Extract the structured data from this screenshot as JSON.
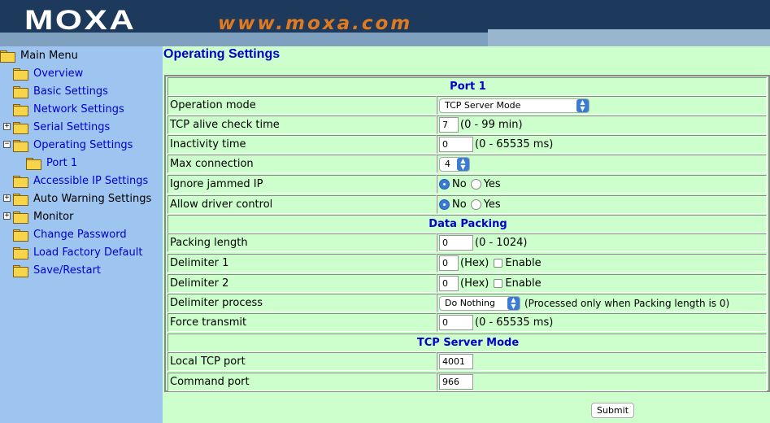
{
  "header": {
    "logo": "MOXA",
    "site": "www.moxa.com"
  },
  "sidebar": {
    "items": [
      {
        "label": "Main Menu",
        "level": 0,
        "toggle": "",
        "root": true
      },
      {
        "label": "Overview",
        "level": 1,
        "toggle": ""
      },
      {
        "label": "Basic Settings",
        "level": 1,
        "toggle": ""
      },
      {
        "label": "Network Settings",
        "level": 1,
        "toggle": ""
      },
      {
        "label": "Serial Settings",
        "level": 1,
        "toggle": "+"
      },
      {
        "label": "Operating Settings",
        "level": 1,
        "toggle": "−"
      },
      {
        "label": "Port 1",
        "level": 2,
        "toggle": ""
      },
      {
        "label": "Accessible IP Settings",
        "level": 1,
        "toggle": ""
      },
      {
        "label": "Auto Warning Settings",
        "level": 1,
        "toggle": "+",
        "dark": true
      },
      {
        "label": "Monitor",
        "level": 1,
        "toggle": "+",
        "dark": true
      },
      {
        "label": "Change Password",
        "level": 1,
        "toggle": ""
      },
      {
        "label": "Load Factory Default",
        "level": 1,
        "toggle": ""
      },
      {
        "label": "Save/Restart",
        "level": 1,
        "toggle": ""
      }
    ]
  },
  "main": {
    "title": "Operating Settings",
    "sections": {
      "port": "Port 1",
      "packing": "Data Packing",
      "tcp": "TCP Server Mode"
    },
    "fields": {
      "operation_mode": {
        "label": "Operation mode",
        "value": "TCP Server Mode"
      },
      "tcp_alive": {
        "label": "TCP alive check time",
        "value": "7",
        "hint": "(0 - 99 min)"
      },
      "inactivity": {
        "label": "Inactivity time",
        "value": "0",
        "hint": "(0 - 65535 ms)"
      },
      "max_conn": {
        "label": "Max connection",
        "value": "4"
      },
      "ignore_jammed": {
        "label": "Ignore jammed IP",
        "no": "No",
        "yes": "Yes",
        "selected": "No"
      },
      "allow_driver": {
        "label": "Allow driver control",
        "no": "No",
        "yes": "Yes",
        "selected": "No"
      },
      "packing_length": {
        "label": "Packing length",
        "value": "0",
        "hint": "(0 - 1024)"
      },
      "delimiter1": {
        "label": "Delimiter 1",
        "value": "0",
        "hex": "(Hex)",
        "enable": "Enable"
      },
      "delimiter2": {
        "label": "Delimiter 2",
        "value": "0",
        "hex": "(Hex)",
        "enable": "Enable"
      },
      "delimiter_process": {
        "label": "Delimiter process",
        "value": "Do Nothing",
        "hint": "(Processed only when Packing length is 0)"
      },
      "force_transmit": {
        "label": "Force transmit",
        "value": "0",
        "hint": "(0 - 65535 ms)"
      },
      "local_tcp_port": {
        "label": "Local TCP port",
        "value": "4001"
      },
      "command_port": {
        "label": "Command port",
        "value": "966"
      }
    },
    "submit": "Submit"
  }
}
